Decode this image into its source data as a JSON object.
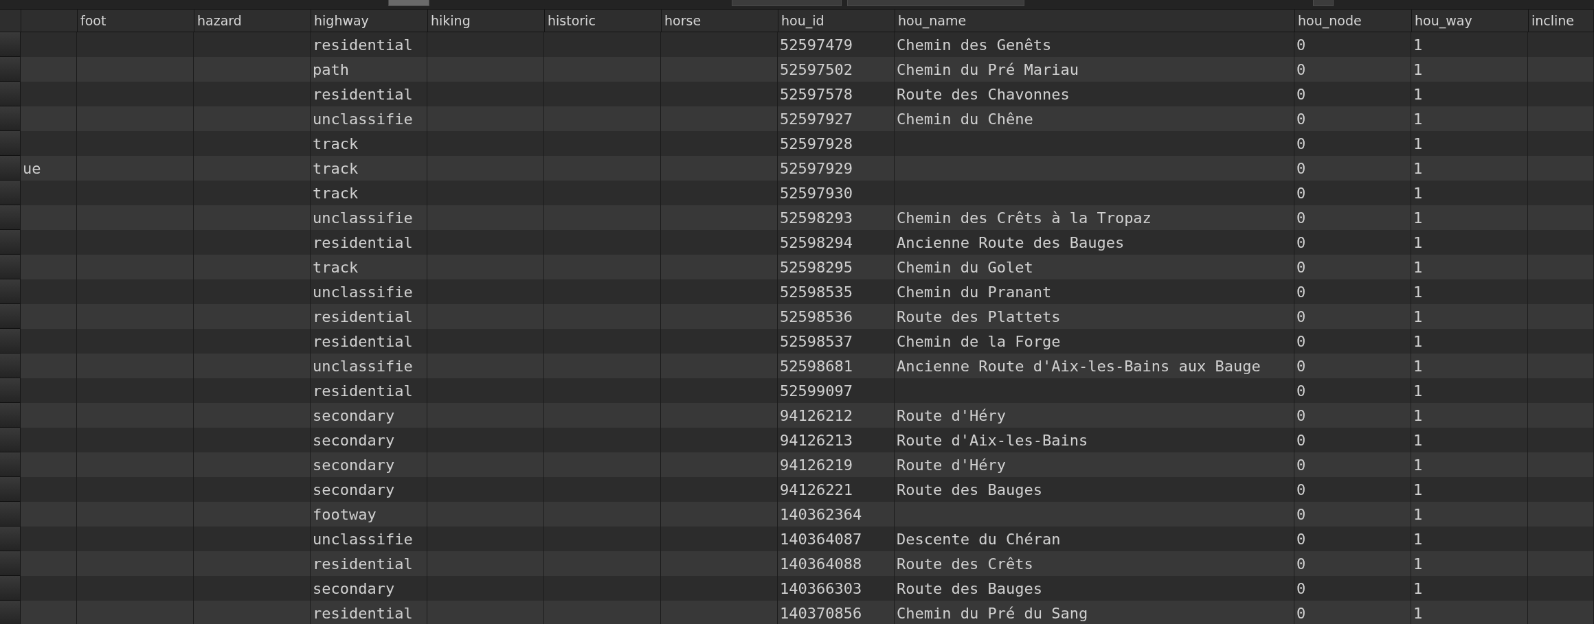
{
  "table": {
    "headers": [
      "foot",
      "hazard",
      "highway",
      "hiking",
      "historic",
      "horse",
      "hou_id",
      "hou_name",
      "hou_node",
      "hou_way",
      "incline"
    ],
    "rows": [
      [
        null,
        null,
        null,
        "residential",
        null,
        null,
        null,
        "52597479",
        "Chemin des Genêts",
        "0",
        "1",
        null
      ],
      [
        null,
        null,
        null,
        "path",
        null,
        null,
        null,
        "52597502",
        "Chemin du Pré Mariau",
        "0",
        "1",
        null
      ],
      [
        null,
        null,
        null,
        "residential",
        null,
        null,
        null,
        "52597578",
        "Route des Chavonnes",
        "0",
        "1",
        null
      ],
      [
        null,
        null,
        null,
        "unclassifie",
        null,
        null,
        null,
        "52597927",
        "Chemin du Chêne",
        "0",
        "1",
        null
      ],
      [
        null,
        null,
        null,
        "track",
        null,
        null,
        null,
        "52597928",
        null,
        "0",
        "1",
        null
      ],
      [
        "ue",
        null,
        null,
        "track",
        null,
        null,
        null,
        "52597929",
        null,
        "0",
        "1",
        null
      ],
      [
        null,
        null,
        null,
        "track",
        null,
        null,
        null,
        "52597930",
        null,
        "0",
        "1",
        null
      ],
      [
        null,
        null,
        null,
        "unclassifie",
        null,
        null,
        null,
        "52598293",
        "Chemin des Crêts à la Tropaz",
        "0",
        "1",
        null
      ],
      [
        null,
        null,
        null,
        "residential",
        null,
        null,
        null,
        "52598294",
        "Ancienne Route des Bauges",
        "0",
        "1",
        null
      ],
      [
        null,
        null,
        null,
        "track",
        null,
        null,
        null,
        "52598295",
        "Chemin du Golet",
        "0",
        "1",
        null
      ],
      [
        null,
        null,
        null,
        "unclassifie",
        null,
        null,
        null,
        "52598535",
        "Chemin du Pranant",
        "0",
        "1",
        null
      ],
      [
        null,
        null,
        null,
        "residential",
        null,
        null,
        null,
        "52598536",
        "Route des Plattets",
        "0",
        "1",
        null
      ],
      [
        null,
        null,
        null,
        "residential",
        null,
        null,
        null,
        "52598537",
        "Chemin de la Forge",
        "0",
        "1",
        null
      ],
      [
        null,
        null,
        null,
        "unclassifie",
        null,
        null,
        null,
        "52598681",
        "Ancienne Route d'Aix-les-Bains aux Bauge",
        "0",
        "1",
        null
      ],
      [
        null,
        null,
        null,
        "residential",
        null,
        null,
        null,
        "52599097",
        null,
        "0",
        "1",
        null
      ],
      [
        null,
        null,
        null,
        "secondary",
        null,
        null,
        null,
        "94126212",
        "Route d'Héry",
        "0",
        "1",
        null
      ],
      [
        null,
        null,
        null,
        "secondary",
        null,
        null,
        null,
        "94126213",
        "Route d'Aix-les-Bains",
        "0",
        "1",
        null
      ],
      [
        null,
        null,
        null,
        "secondary",
        null,
        null,
        null,
        "94126219",
        "Route d'Héry",
        "0",
        "1",
        null
      ],
      [
        null,
        null,
        null,
        "secondary",
        null,
        null,
        null,
        "94126221",
        "Route des Bauges",
        "0",
        "1",
        null
      ],
      [
        null,
        null,
        null,
        "footway",
        null,
        null,
        null,
        "140362364",
        null,
        "0",
        "1",
        null
      ],
      [
        null,
        null,
        null,
        "unclassifie",
        null,
        null,
        null,
        "140364087",
        "Descente du Chéran",
        "0",
        "1",
        null
      ],
      [
        null,
        null,
        null,
        "residential",
        null,
        null,
        null,
        "140364088",
        "Route des Crêts",
        "0",
        "1",
        null
      ],
      [
        null,
        null,
        null,
        "secondary",
        null,
        null,
        null,
        "140366303",
        "Route des Bauges",
        "0",
        "1",
        null
      ],
      [
        null,
        null,
        null,
        "residential",
        null,
        null,
        null,
        "140370856",
        "Chemin du Pré du Sang",
        "0",
        "1",
        null
      ]
    ]
  }
}
